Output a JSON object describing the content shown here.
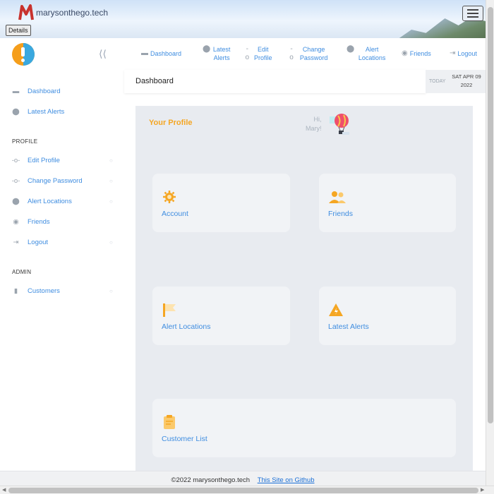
{
  "brand": {
    "name": "marysonthego.tech"
  },
  "tooltip": "Details",
  "topnav": [
    {
      "label": "Dashboard",
      "icon": "keyboard-icon"
    },
    {
      "label": "Latest Alerts",
      "icon": "map-pin-icon"
    },
    {
      "label": "Edit Profile",
      "icon": "link-icon"
    },
    {
      "label": "Change Password",
      "icon": "link-icon"
    },
    {
      "label": "Alert Locations",
      "icon": "map-pin-icon"
    },
    {
      "label": "Friends",
      "icon": "people-icon"
    },
    {
      "label": "Logout",
      "icon": "logout-icon"
    }
  ],
  "sidebar": {
    "items_top": [
      {
        "label": "Dashboard",
        "icon": "keyboard-icon"
      },
      {
        "label": "Latest Alerts",
        "icon": "map-pin-icon"
      }
    ],
    "profile_heading": "PROFILE",
    "profile_items": [
      {
        "label": "Edit Profile",
        "icon": "link-icon"
      },
      {
        "label": "Change Password",
        "icon": "link-icon"
      },
      {
        "label": "Alert Locations",
        "icon": "map-pin-icon"
      },
      {
        "label": "Friends",
        "icon": "people-icon"
      },
      {
        "label": "Logout",
        "icon": "logout-icon"
      }
    ],
    "admin_heading": "ADMIN",
    "admin_items": [
      {
        "label": "Customers",
        "icon": "clipboard-icon"
      }
    ]
  },
  "header": {
    "title": "Dashboard",
    "today": "TODAY",
    "date": "SAT APR 09 2022"
  },
  "main": {
    "profile_title": "Your Profile",
    "greeting_line1": "Hi,",
    "greeting_line2": "Mary!",
    "cards": [
      {
        "label": "Account",
        "icon": "gear-icon"
      },
      {
        "label": "Friends",
        "icon": "people-icon"
      },
      {
        "label": "Alert Locations",
        "icon": "flag-icon"
      },
      {
        "label": "Latest Alerts",
        "icon": "warning-icon"
      },
      {
        "label": "Customer List",
        "icon": "clipboard-icon"
      }
    ]
  },
  "footer": {
    "copyright": "©2022 marysonthego.tech",
    "link": "This Site on Github"
  },
  "colors": {
    "accent": "#3f8de0",
    "orange": "#f5a623",
    "panel": "#e8ebf0",
    "card": "#f1f3f6"
  }
}
